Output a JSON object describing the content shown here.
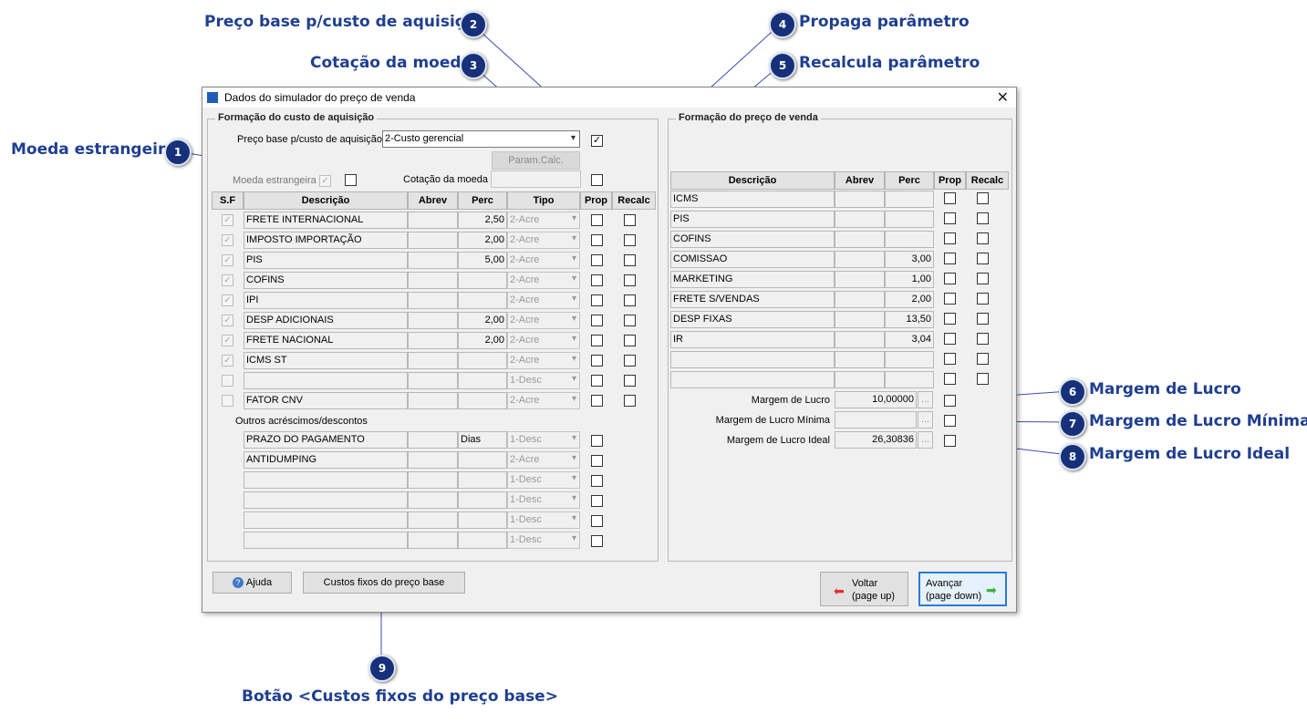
{
  "callouts": [
    {
      "num": "1",
      "label": "Moeda estrangeira"
    },
    {
      "num": "2",
      "label": "Preço base p/custo de aquisição"
    },
    {
      "num": "3",
      "label": "Cotação da moeda"
    },
    {
      "num": "4",
      "label": "Propaga parâmetro"
    },
    {
      "num": "5",
      "label": "Recalcula parâmetro"
    },
    {
      "num": "6",
      "label": "Margem de Lucro"
    },
    {
      "num": "7",
      "label": "Margem de Lucro Mínima"
    },
    {
      "num": "8",
      "label": "Margem de Lucro Ideal"
    },
    {
      "num": "9",
      "label": "Botão <Custos fixos do preço base>"
    }
  ],
  "window": {
    "title": "Dados do simulador do preço de venda",
    "close": "✕"
  },
  "left": {
    "group_title": "Formação do custo de aquisição",
    "preco_base_label": "Preço base p/custo de aquisição",
    "preco_base_value": "2-Custo gerencial",
    "param_calc": "Param.Calc.",
    "moeda_label": "Moeda estrangeira",
    "cotacao_label": "Cotação da moeda",
    "headers": [
      "S.F",
      "Descrição",
      "Abrev",
      "Perc",
      "Tipo",
      "Prop",
      "Recalc"
    ],
    "rows": [
      {
        "sf": true,
        "desc": "FRETE INTERNACIONAL",
        "abrev": "",
        "perc": "2,50",
        "tipo": "2-Acre"
      },
      {
        "sf": true,
        "desc": "IMPOSTO IMPORTAÇÃO",
        "abrev": "",
        "perc": "2,00",
        "tipo": "2-Acre"
      },
      {
        "sf": true,
        "desc": "PIS",
        "abrev": "",
        "perc": "5,00",
        "tipo": "2-Acre"
      },
      {
        "sf": true,
        "desc": "COFINS",
        "abrev": "",
        "perc": "",
        "tipo": "2-Acre"
      },
      {
        "sf": true,
        "desc": "IPI",
        "abrev": "",
        "perc": "",
        "tipo": "2-Acre"
      },
      {
        "sf": true,
        "desc": "DESP ADICIONAIS",
        "abrev": "",
        "perc": "2,00",
        "tipo": "2-Acre"
      },
      {
        "sf": true,
        "desc": "FRETE NACIONAL",
        "abrev": "",
        "perc": "2,00",
        "tipo": "2-Acre"
      },
      {
        "sf": true,
        "desc": "ICMS ST",
        "abrev": "",
        "perc": "",
        "tipo": "2-Acre"
      },
      {
        "sf": false,
        "desc": "",
        "abrev": "",
        "perc": "",
        "tipo": "1-Desc"
      },
      {
        "sf": false,
        "desc": "FATOR CNV",
        "abrev": "",
        "perc": "",
        "tipo": "2-Acre"
      }
    ],
    "outros_label": "Outros acréscimos/descontos",
    "outros": [
      {
        "desc": "PRAZO DO PAGAMENTO",
        "abrev": "",
        "perc": "Dias",
        "tipo": "1-Desc"
      },
      {
        "desc": "ANTIDUMPING",
        "abrev": "",
        "perc": "",
        "tipo": "2-Acre"
      },
      {
        "desc": "",
        "abrev": "",
        "perc": "",
        "tipo": "1-Desc"
      },
      {
        "desc": "",
        "abrev": "",
        "perc": "",
        "tipo": "1-Desc"
      },
      {
        "desc": "",
        "abrev": "",
        "perc": "",
        "tipo": "1-Desc"
      },
      {
        "desc": "",
        "abrev": "",
        "perc": "",
        "tipo": "1-Desc"
      }
    ]
  },
  "right": {
    "group_title": "Formação do preço de venda",
    "headers": [
      "Descrição",
      "Abrev",
      "Perc",
      "Prop",
      "Recalc"
    ],
    "rows": [
      {
        "desc": "ICMS",
        "abrev": "",
        "perc": ""
      },
      {
        "desc": "PIS",
        "abrev": "",
        "perc": ""
      },
      {
        "desc": "COFINS",
        "abrev": "",
        "perc": ""
      },
      {
        "desc": "COMISSAO",
        "abrev": "",
        "perc": "3,00"
      },
      {
        "desc": "MARKETING",
        "abrev": "",
        "perc": "1,00"
      },
      {
        "desc": "FRETE S/VENDAS",
        "abrev": "",
        "perc": "2,00"
      },
      {
        "desc": "DESP FIXAS",
        "abrev": "",
        "perc": "13,50"
      },
      {
        "desc": "IR",
        "abrev": "",
        "perc": "3,04"
      },
      {
        "desc": "",
        "abrev": "",
        "perc": ""
      },
      {
        "desc": "",
        "abrev": "",
        "perc": ""
      }
    ],
    "margens": [
      {
        "label": "Margem de Lucro",
        "value": "10,00000"
      },
      {
        "label": "Margem de Lucro Mínima",
        "value": ""
      },
      {
        "label": "Margem de Lucro Ideal",
        "value": "26,30836"
      }
    ],
    "ellipsis": "..."
  },
  "buttons": {
    "ajuda": "Ajuda",
    "custos": "Custos fixos do preço base",
    "voltar_1": "Voltar",
    "voltar_2": "(page up)",
    "avancar_1": "Avançar",
    "avancar_2": "(page down)"
  },
  "colors": {
    "callout": "#1f3f8f",
    "badge": "#16317a",
    "line": "#3a4fa8"
  }
}
